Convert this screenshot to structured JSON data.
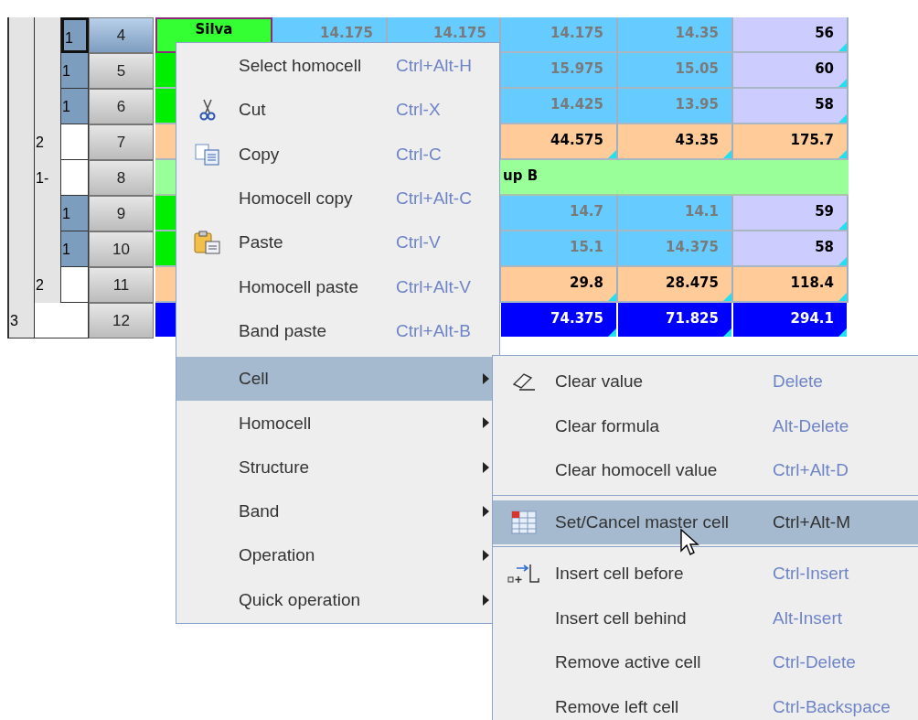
{
  "sheet": {
    "rows": [
      {
        "number": "4",
        "kind": "detail",
        "selected": true,
        "band_col_3": "1",
        "cells": [
          "Silva",
          "14.175",
          "14.175",
          "14.175",
          "14.35",
          "56"
        ]
      },
      {
        "number": "5",
        "kind": "detail",
        "selected": false,
        "band_col_3": "1",
        "cells": [
          "15.975",
          "15.05",
          "60"
        ]
      },
      {
        "number": "6",
        "kind": "detail",
        "selected": false,
        "band_col_3": "1",
        "cells": [
          "14.425",
          "13.95",
          "58"
        ]
      },
      {
        "number": "7",
        "kind": "subtotal",
        "selected": false,
        "band_col_2": "2",
        "cells": [
          "44.575",
          "43.35",
          "175.7"
        ]
      },
      {
        "number": "8",
        "kind": "group",
        "selected": false,
        "band_col_2": "1-",
        "label": "up B"
      },
      {
        "number": "9",
        "kind": "detail",
        "selected": false,
        "band_col_3": "1",
        "cells": [
          "14.7",
          "14.1",
          "59"
        ]
      },
      {
        "number": "10",
        "kind": "detail",
        "selected": false,
        "band_col_3": "1",
        "cells": [
          "15.1",
          "14.375",
          "58"
        ]
      },
      {
        "number": "11",
        "kind": "subtotal",
        "selected": false,
        "band_col_2": "2",
        "cells": [
          "29.8",
          "28.475",
          "118.4"
        ]
      },
      {
        "number": "12",
        "kind": "total",
        "selected": false,
        "band_col_1": "3",
        "cells": [
          "74.375",
          "71.825",
          "294.1"
        ]
      }
    ]
  },
  "context_menu": {
    "items": [
      {
        "kind": "item",
        "label": "Select homocell",
        "shortcut": "Ctrl+Alt-H",
        "selected": false
      },
      {
        "kind": "item",
        "label": "Cut",
        "shortcut": "Ctrl-X",
        "selected": false
      },
      {
        "kind": "item",
        "label": "Copy",
        "shortcut": "Ctrl-C",
        "selected": false
      },
      {
        "kind": "item",
        "label": "Homocell copy",
        "shortcut": "Ctrl+Alt-C",
        "selected": false
      },
      {
        "kind": "item",
        "label": "Paste",
        "shortcut": "Ctrl-V",
        "selected": false
      },
      {
        "kind": "item",
        "label": "Homocell paste",
        "shortcut": "Ctrl+Alt-V",
        "selected": false
      },
      {
        "kind": "item",
        "label": "Band paste",
        "shortcut": "Ctrl+Alt-B",
        "selected": false
      },
      {
        "kind": "separator"
      },
      {
        "kind": "submenu",
        "label": "Cell",
        "selected": true
      },
      {
        "kind": "submenu",
        "label": "Homocell",
        "selected": false
      },
      {
        "kind": "submenu",
        "label": "Structure",
        "selected": false
      },
      {
        "kind": "submenu",
        "label": "Band",
        "selected": false
      },
      {
        "kind": "submenu",
        "label": "Operation",
        "selected": false
      },
      {
        "kind": "submenu",
        "label": "Quick operation",
        "selected": false
      }
    ]
  },
  "cell_submenu": {
    "items": [
      {
        "kind": "item",
        "label": "Clear value",
        "shortcut": "Delete",
        "selected": false
      },
      {
        "kind": "item",
        "label": "Clear formula",
        "shortcut": "Alt-Delete",
        "selected": false
      },
      {
        "kind": "item",
        "label": "Clear homocell value",
        "shortcut": "Ctrl+Alt-D",
        "selected": false
      },
      {
        "kind": "separator"
      },
      {
        "kind": "item",
        "label": "Set/Cancel master cell",
        "shortcut": "Ctrl+Alt-M",
        "selected": true
      },
      {
        "kind": "separator"
      },
      {
        "kind": "item",
        "label": "Insert cell before",
        "shortcut": "Ctrl-Insert",
        "selected": false
      },
      {
        "kind": "item",
        "label": "Insert cell behind",
        "shortcut": "Alt-Insert",
        "selected": false
      },
      {
        "kind": "item",
        "label": "Remove active cell",
        "shortcut": "Ctrl-Delete",
        "selected": false
      },
      {
        "kind": "item",
        "label": "Remove left cell",
        "shortcut": "Ctrl-Backspace",
        "selected": false
      }
    ]
  }
}
